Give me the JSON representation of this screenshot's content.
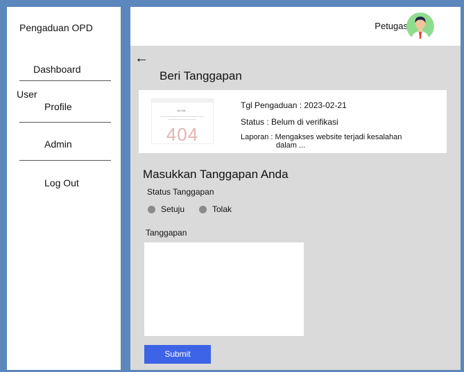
{
  "sidebar": {
    "brand": "Pengaduan OPD",
    "items": [
      {
        "label": "Dashboard"
      },
      {
        "label": "User",
        "label2": "Profile"
      },
      {
        "label": "Admin"
      },
      {
        "label": "Log Out"
      }
    ]
  },
  "header": {
    "role": "Petugas"
  },
  "main": {
    "back_icon": "←",
    "title": "Beri Tanggapan",
    "complaint": {
      "thumbnail_heading": "Uh Oh...",
      "thumbnail_code": "404",
      "date_label": "Tgl Pengaduan : 2023-02-21",
      "status_label": "Status : Belum di verifikasi",
      "report_label": "Laporan : Mengakses website terjadi kesalahan",
      "report_continued": "dalam ..."
    },
    "form": {
      "section_title": "Masukkan Tanggapan Anda",
      "status_label": "Status Tanggapan",
      "options": [
        "Setuju",
        "Tolak"
      ],
      "response_label": "Tanggapan",
      "response_value": "",
      "submit_label": "Submit"
    }
  },
  "colors": {
    "frame": "#5b87bd",
    "content_bg": "#dadada",
    "submit": "#3d63e6",
    "radio": "#8a8a8a"
  }
}
